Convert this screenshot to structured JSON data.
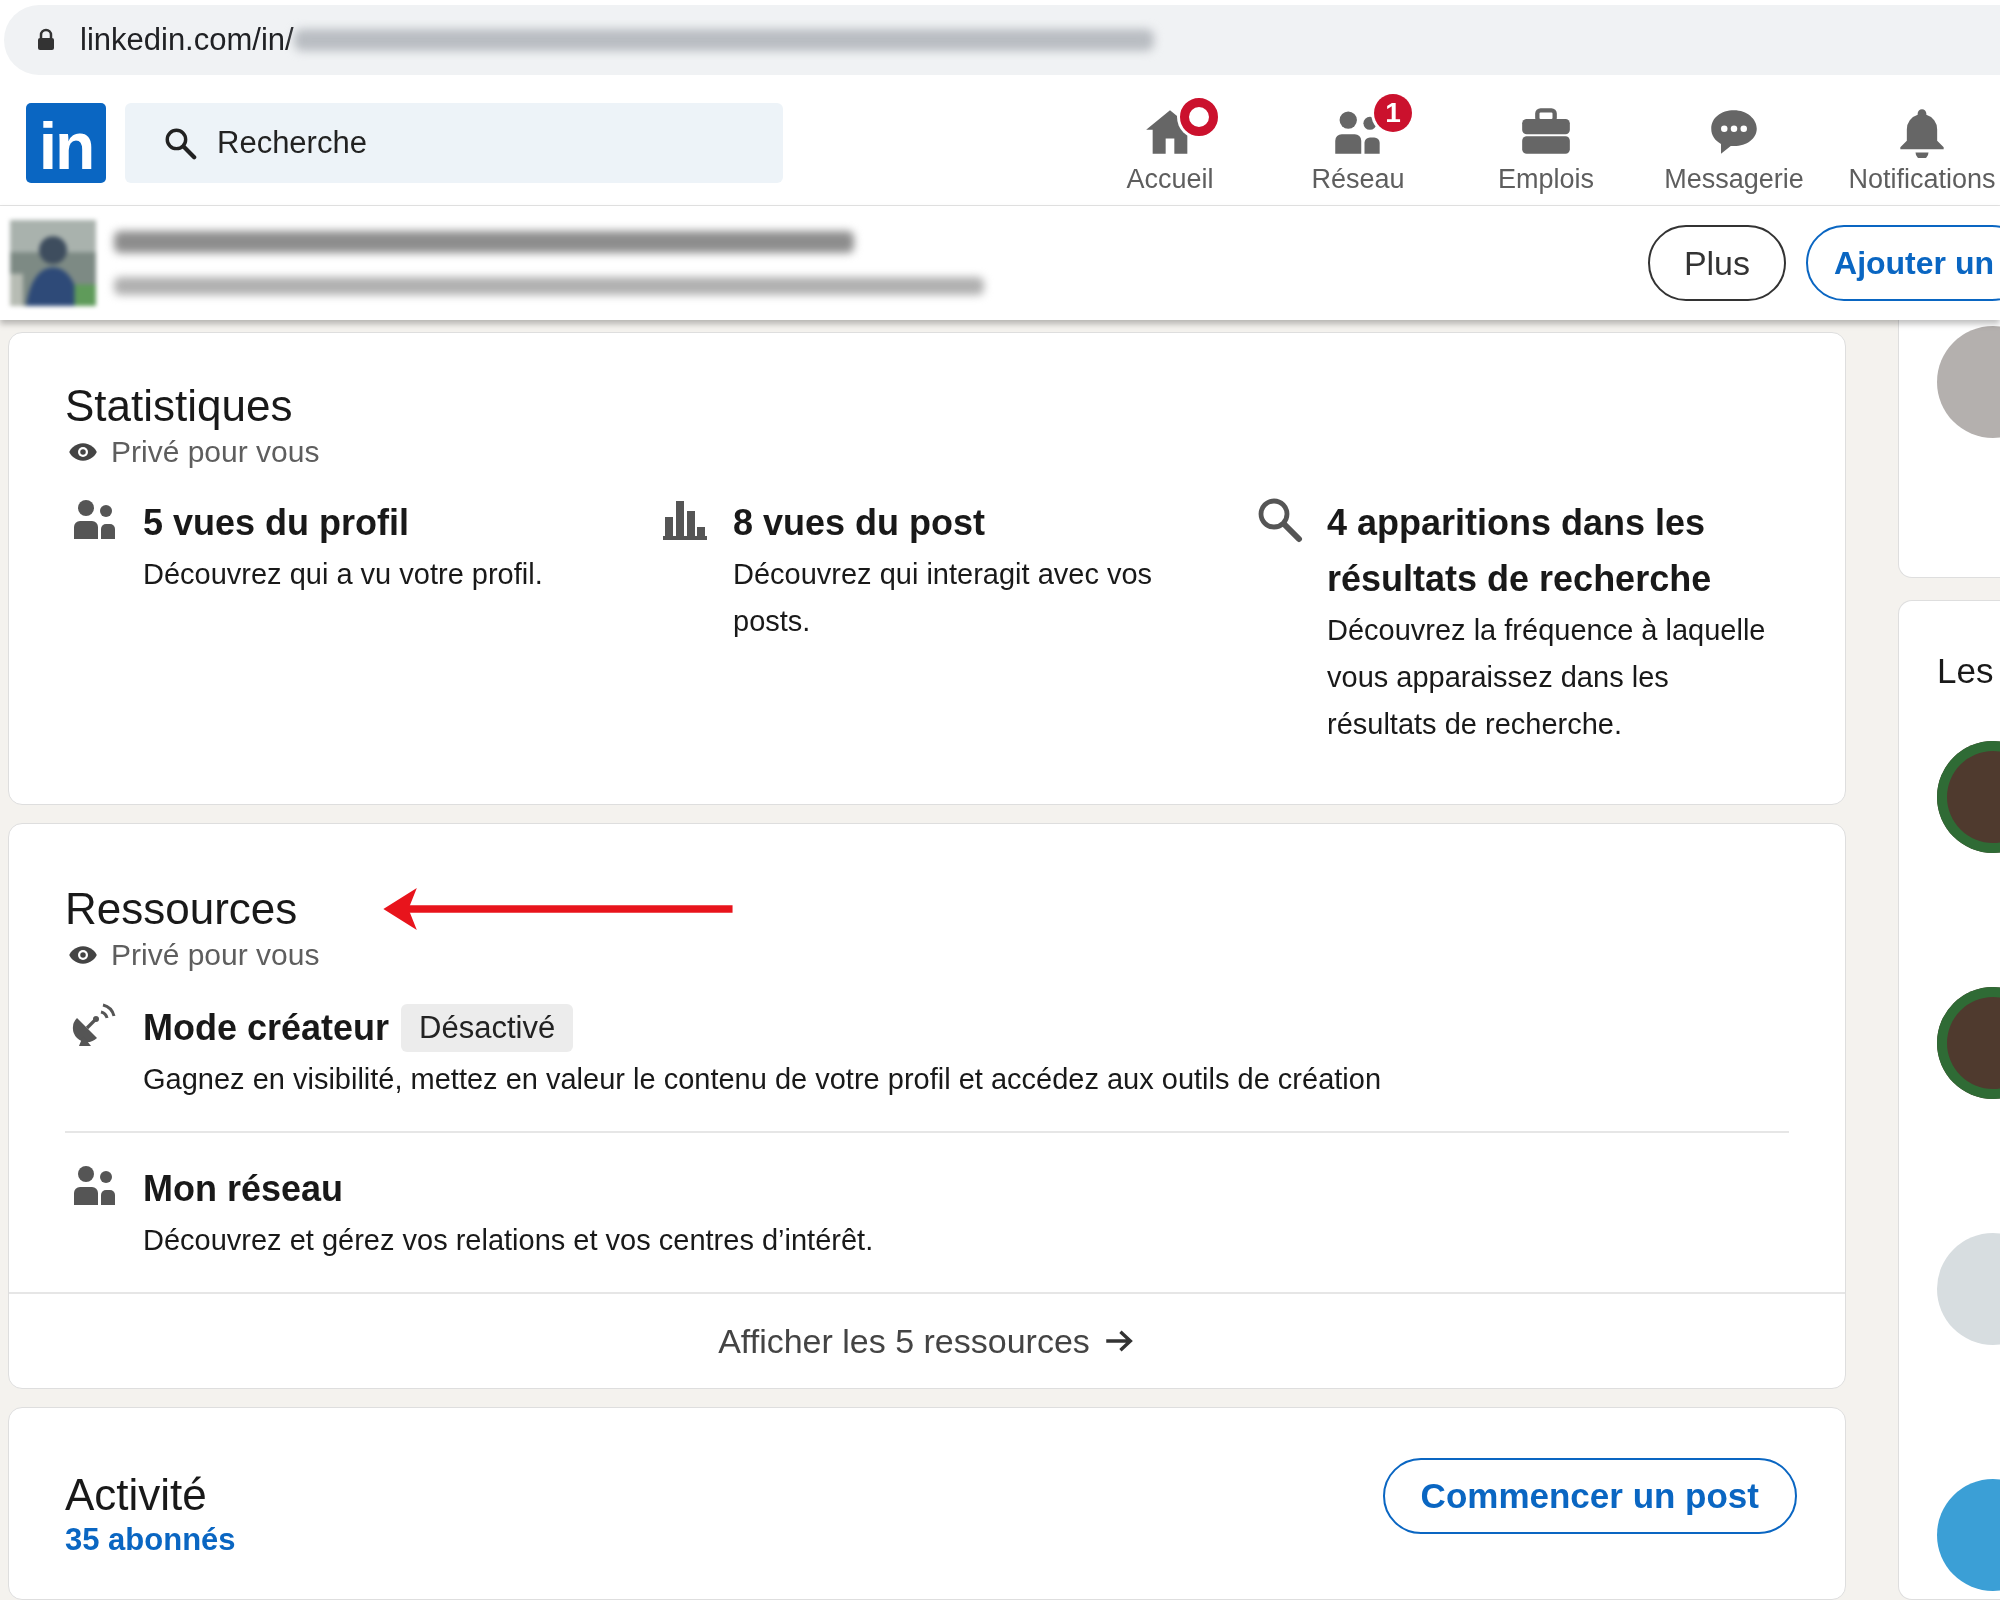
{
  "browser": {
    "url": "linkedin.com/in/"
  },
  "nav": {
    "logo": "in",
    "search": {
      "placeholder": "Recherche"
    },
    "items": [
      {
        "label": "Accueil",
        "kind": "home",
        "badge": {
          "kind": "dot"
        }
      },
      {
        "label": "Réseau",
        "kind": "people",
        "badge": {
          "kind": "count",
          "text": "1"
        }
      },
      {
        "label": "Emplois",
        "kind": "briefcase"
      },
      {
        "label": "Messagerie",
        "kind": "chat"
      },
      {
        "label": "Notifications",
        "kind": "bell"
      }
    ]
  },
  "profile_bar": {
    "buttons": [
      {
        "label": "Plus",
        "kind": "secondary"
      },
      {
        "label": "Ajouter un",
        "kind": "primary"
      }
    ]
  },
  "statistics": {
    "title": "Statistiques",
    "privacy": "Privé pour vous",
    "items": [
      {
        "kind": "people",
        "title": "5 vues du profil",
        "text": "Découvrez qui a vu votre profil."
      },
      {
        "kind": "chart",
        "title": "8 vues du post",
        "text": "Découvrez qui interagit avec vos posts."
      },
      {
        "kind": "search",
        "title": "4 apparitions dans les résultats de recherche",
        "text": "Découvrez la fréquence à laquelle vous apparaissez dans les résultats de recherche."
      }
    ]
  },
  "resources": {
    "title": "Ressources",
    "privacy": "Privé pour vous",
    "items": [
      {
        "kind": "dish",
        "title": "Mode créateur",
        "tag": "Désactivé",
        "text": "Gagnez en visibilité, mettez en valeur le contenu de votre profil et accédez aux outils de création"
      },
      {
        "kind": "people",
        "title": "Mon réseau",
        "text": "Découvrez et gérez vos relations et vos centres d’intérêt."
      }
    ],
    "footer": "Afficher les 5 ressources"
  },
  "activity": {
    "title": "Activité",
    "followers": "35 abonnés",
    "button": "Commencer un post"
  },
  "sidebar": {
    "heading": "Les"
  }
}
